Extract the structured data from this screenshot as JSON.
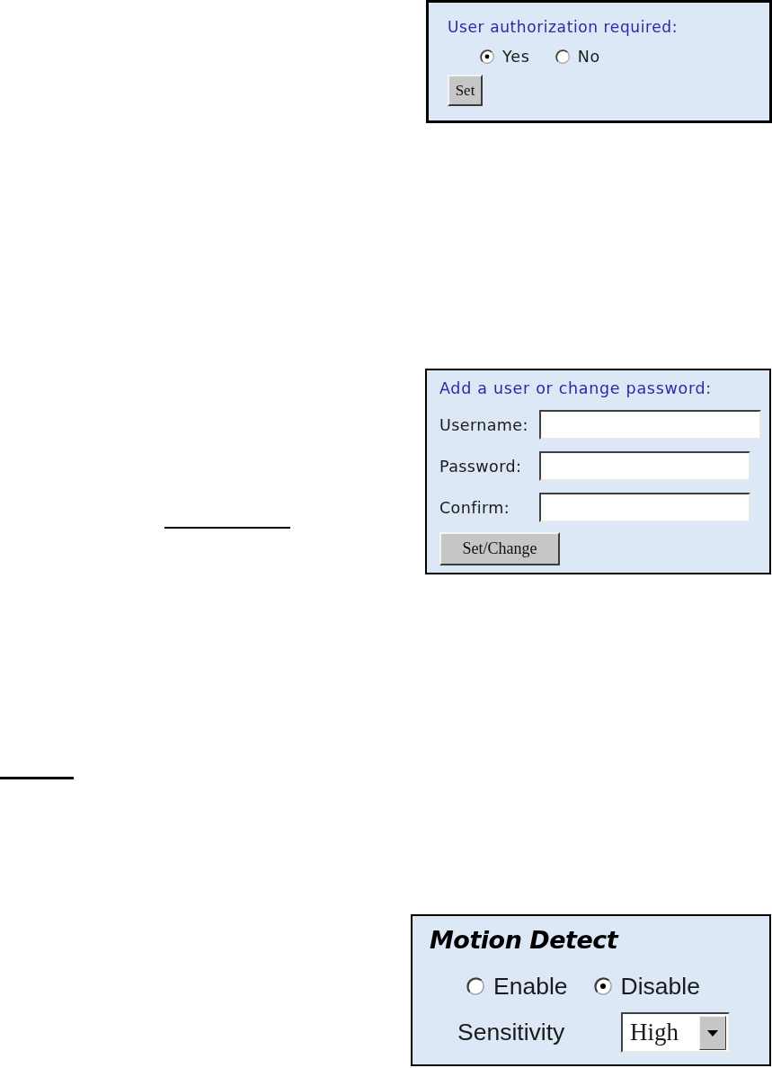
{
  "user_authorization": {
    "title": "User authorization required:",
    "options": [
      {
        "label": "Yes",
        "selected": true
      },
      {
        "label": "No",
        "selected": false
      }
    ],
    "button": "Set"
  },
  "add_user": {
    "title": "Add a user or change password:",
    "fields": [
      {
        "label": "Username:"
      },
      {
        "label": "Password:"
      },
      {
        "label": "Confirm:"
      }
    ],
    "button": "Set/Change"
  },
  "motion_detect": {
    "title": "Motion Detect",
    "options": [
      {
        "label": "Enable",
        "selected": false
      },
      {
        "label": "Disable",
        "selected": true
      }
    ],
    "sensitivity": {
      "label": "Sensitivity",
      "value": "High"
    }
  }
}
